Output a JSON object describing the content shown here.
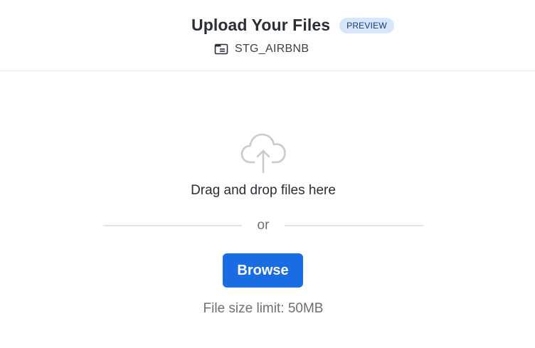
{
  "header": {
    "title": "Upload Your Files",
    "badge": "PREVIEW",
    "database_icon": "database-folder-icon",
    "database_name": "STG_AIRBNB"
  },
  "dropzone": {
    "icon": "cloud-upload-icon",
    "instruction": "Drag and drop files here",
    "separator": "or",
    "browse_label": "Browse",
    "size_limit": "File size limit: 50MB"
  },
  "colors": {
    "accent": "#1a6ce3",
    "badge_bg": "#d8e6fb",
    "badge_text": "#1a3b73",
    "muted_text": "#6b7078",
    "divider": "#e1e3e6"
  }
}
